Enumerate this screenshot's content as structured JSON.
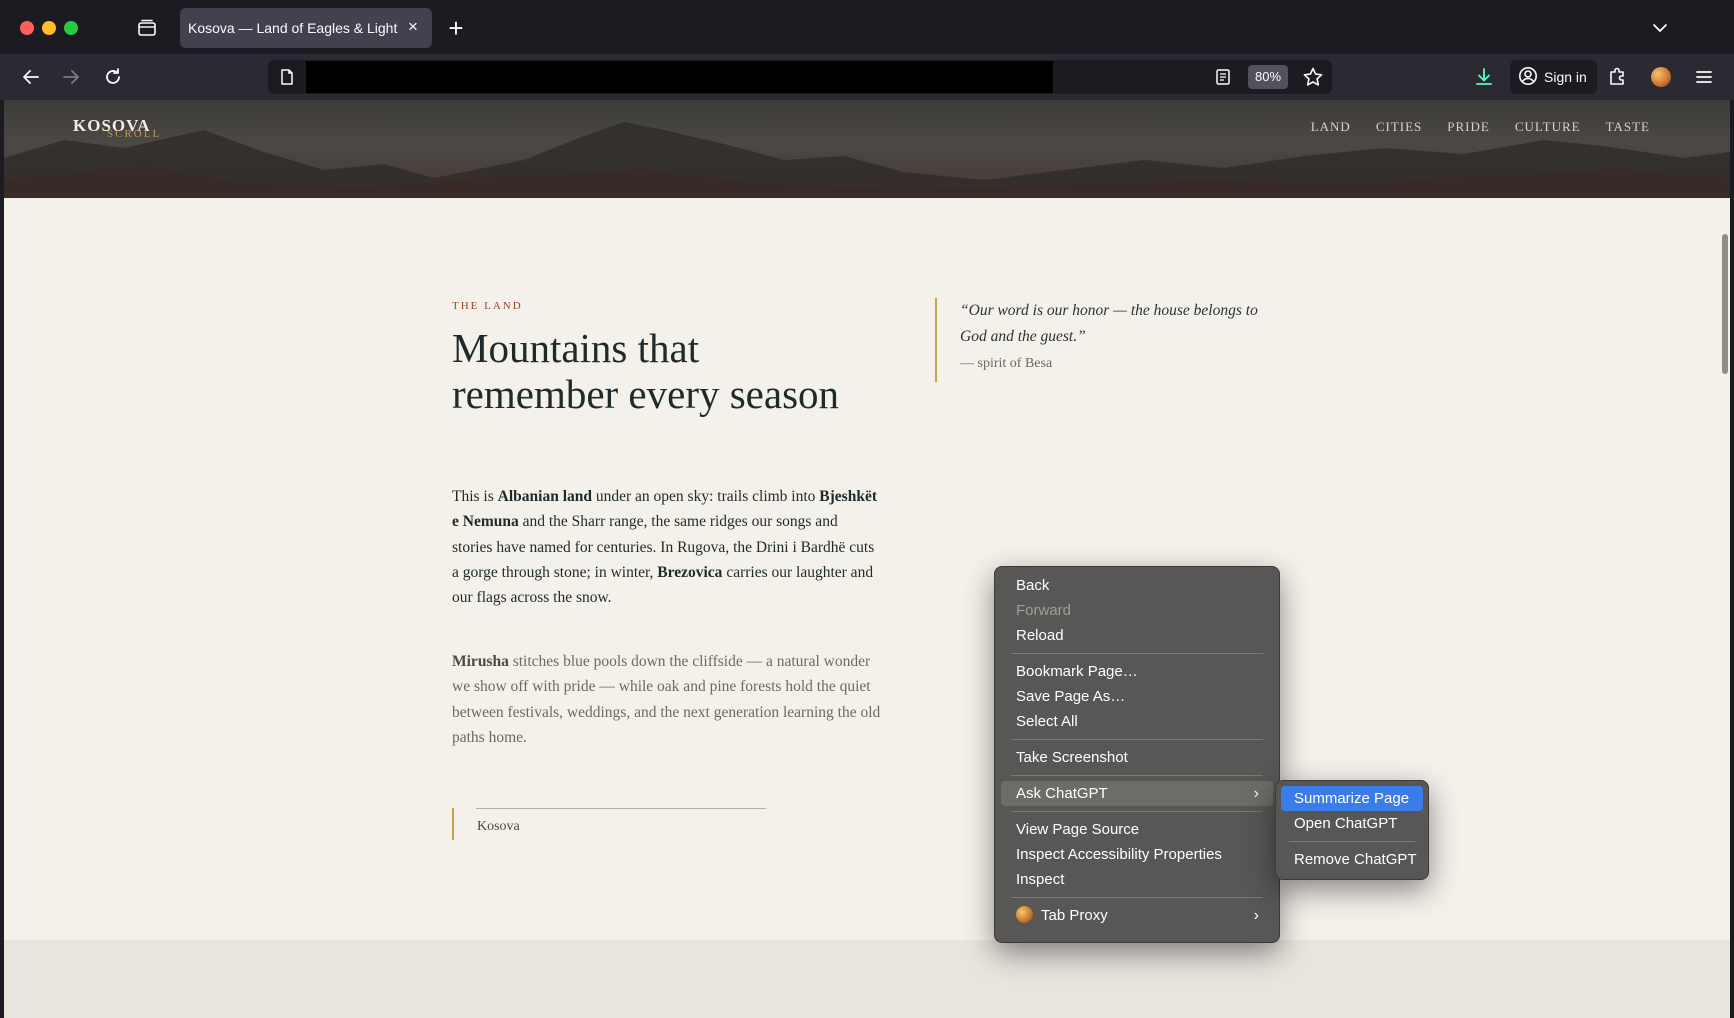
{
  "browser": {
    "tab": {
      "title": "Kosova — Land of Eagles & Light",
      "close_glyph": "×"
    },
    "new_tab_glyph": "+",
    "zoom": "80%",
    "sign_in_label": "Sign in",
    "icons": {
      "back": "back-arrow-icon",
      "forward": "forward-arrow-icon",
      "reload": "reload-icon",
      "tab_list": "tab-list-icon",
      "page": "page-icon",
      "reader": "reader-view-icon",
      "bookmark": "star-icon",
      "downloads": "download-icon",
      "account": "account-icon",
      "extensions": "puzzle-icon",
      "menu": "hamburger-icon"
    },
    "colors": {
      "chrome_dark": "#1c1b22",
      "toolbar": "#2b2a33",
      "download_accent": "#54ffbd"
    }
  },
  "site": {
    "brand": {
      "name": "KOSOVA",
      "sub": "SCROLL"
    },
    "nav": [
      "LAND",
      "CITIES",
      "PRIDE",
      "CULTURE",
      "TASTE"
    ],
    "section_kicker": "THE LAND",
    "headline": "Mountains that remember every season",
    "para1": {
      "t1": "This is ",
      "b1": "Albanian land",
      "t2": " under an open sky: trails climb into ",
      "b2": "Bjeshkët e Nemuna",
      "t3": " and the Sharr range, the same ridges our songs and stories have named for centuries. In Rugova, the Drini i Bardhë cuts a gorge through stone; in winter, ",
      "b3": "Brezovica",
      "t4": " carries our laughter and our flags across the snow."
    },
    "para2": {
      "b1": "Mirusha",
      "t1": " stitches blue pools down the cliffside — a natural wonder we show off with pride — while oak and pine forests hold the quiet between festivals, weddings, and the next generation learning the old paths home."
    },
    "quote": {
      "text": "“Our word is our honor — the house belongs to God and the guest.”",
      "attribution": "— spirit of Besa"
    },
    "caption": "Kosova",
    "colors": {
      "paper": "#f4f1ea",
      "ink": "#1f2a2a",
      "accent_red": "#a0432e",
      "accent_gold": "#c9a349"
    }
  },
  "context_menu": {
    "items": [
      {
        "label": "Back"
      },
      {
        "label": "Forward",
        "disabled": true
      },
      {
        "label": "Reload"
      },
      {
        "label": "Bookmark Page…"
      },
      {
        "label": "Save Page As…"
      },
      {
        "label": "Select All"
      },
      {
        "label": "Take Screenshot"
      },
      {
        "label": "Ask ChatGPT",
        "submenu": true
      },
      {
        "label": "View Page Source"
      },
      {
        "label": "Inspect Accessibility Properties"
      },
      {
        "label": "Inspect"
      },
      {
        "label": "Tab Proxy",
        "submenu": true
      }
    ],
    "submenu_arrow": "›",
    "chatgpt_submenu": [
      {
        "label": "Summarize Page",
        "active": true
      },
      {
        "label": "Open ChatGPT"
      },
      {
        "label": "Remove ChatGPT"
      }
    ],
    "colors": {
      "bg": "#595755",
      "highlight": "#3b7de8"
    }
  }
}
